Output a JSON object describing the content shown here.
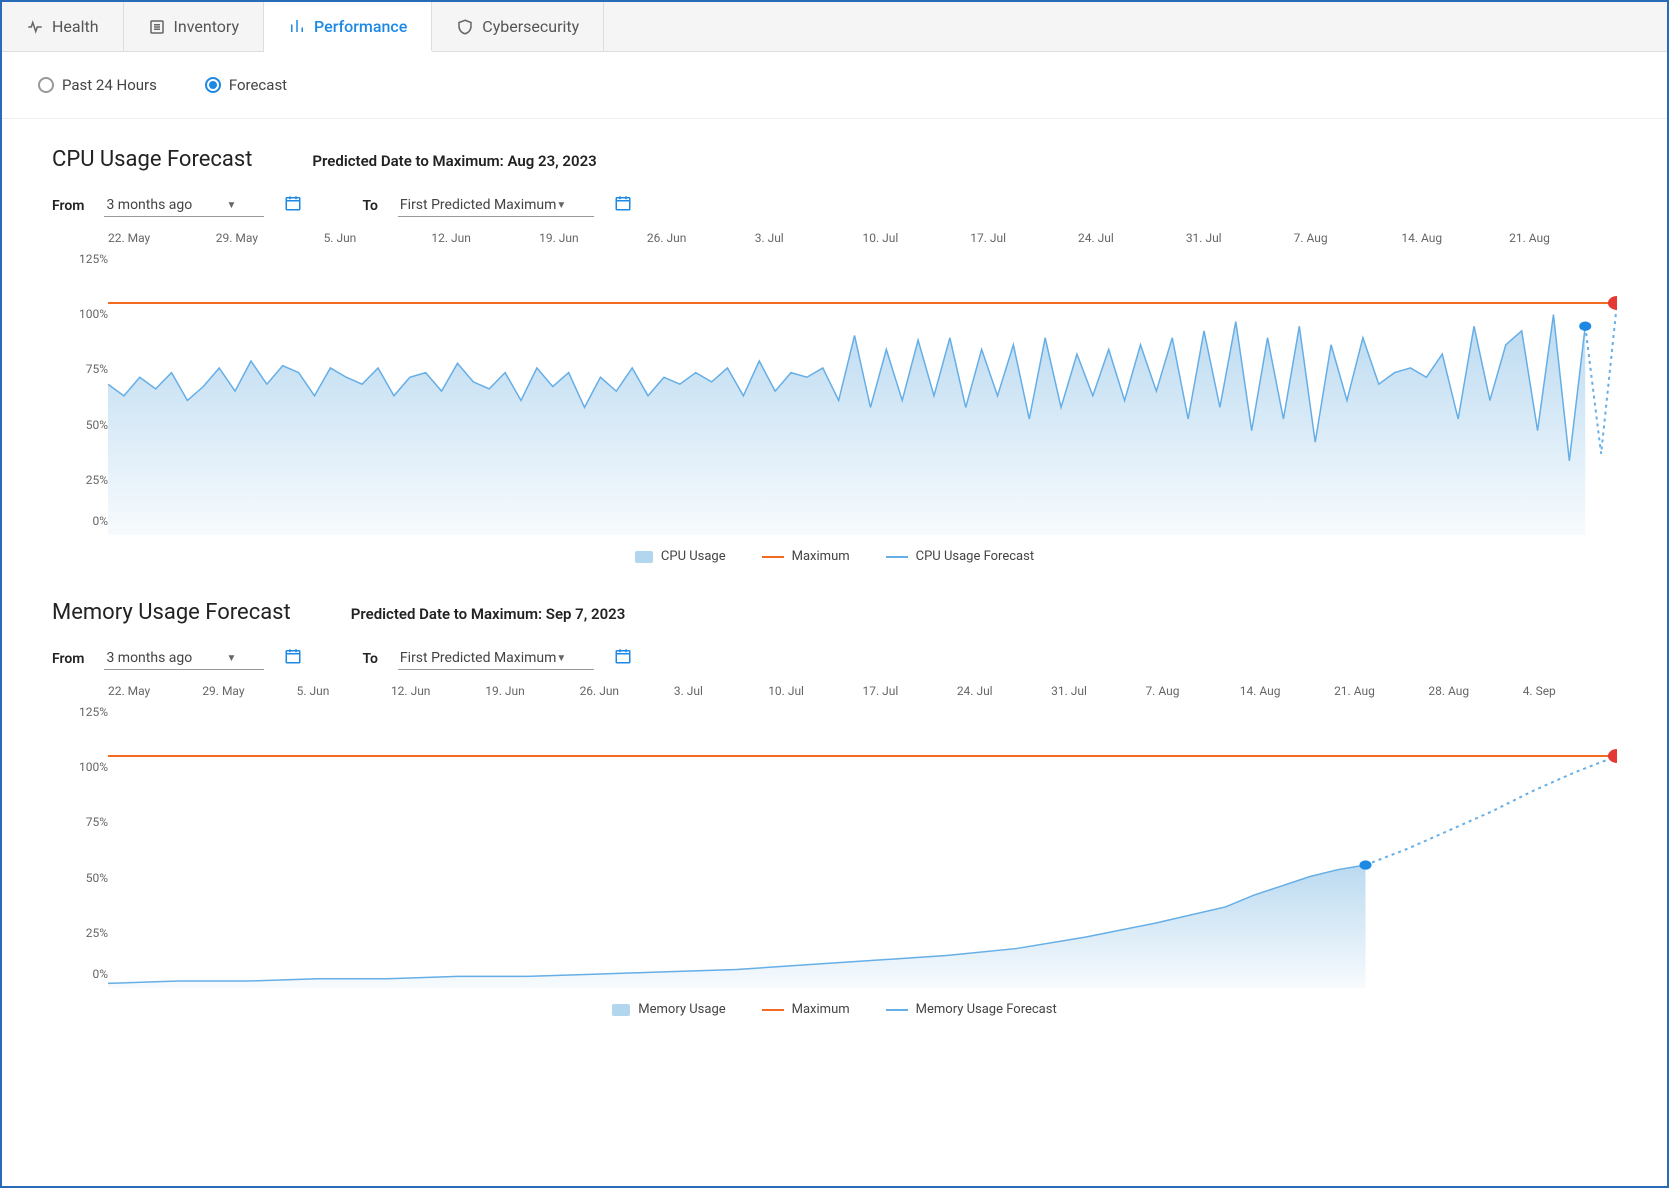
{
  "tabs": [
    {
      "label": "Health",
      "icon": "heart"
    },
    {
      "label": "Inventory",
      "icon": "list"
    },
    {
      "label": "Performance",
      "icon": "bars"
    },
    {
      "label": "Cybersecurity",
      "icon": "shield"
    }
  ],
  "active_tab": 2,
  "time_options": [
    {
      "label": "Past 24 Hours"
    },
    {
      "label": "Forecast"
    }
  ],
  "time_selected": 1,
  "panels": {
    "cpu": {
      "title": "CPU Usage Forecast",
      "subtitle": "Predicted Date to Maximum: Aug 23, 2023",
      "from_label": "From",
      "to_label": "To",
      "from_value": "3 months ago",
      "to_value": "First Predicted Maximum",
      "legend": [
        "CPU Usage",
        "Maximum",
        "CPU Usage Forecast"
      ]
    },
    "mem": {
      "title": "Memory Usage Forecast",
      "subtitle": "Predicted Date to Maximum: Sep 7, 2023",
      "from_label": "From",
      "to_label": "To",
      "from_value": "3 months ago",
      "to_value": "First Predicted Maximum",
      "legend": [
        "Memory Usage",
        "Maximum",
        "Memory Usage Forecast"
      ]
    }
  },
  "chart_data": [
    {
      "type": "area",
      "title": "CPU Usage Forecast",
      "ylabel": "%",
      "ylim": [
        0,
        125
      ],
      "y_ticks": [
        "125%",
        "100%",
        "75%",
        "50%",
        "25%",
        "0%"
      ],
      "x_labels": [
        "22. May",
        "29. May",
        "5. Jun",
        "12. Jun",
        "19. Jun",
        "26. Jun",
        "3. Jul",
        "10. Jul",
        "17. Jul",
        "24. Jul",
        "31. Jul",
        "7. Aug",
        "14. Aug",
        "21. Aug"
      ],
      "max_line": 100,
      "series": [
        {
          "name": "CPU Usage",
          "color": "#b3d6ef",
          "x": [
            0,
            1,
            2,
            3,
            4,
            5,
            6,
            7,
            8,
            9,
            10,
            11,
            12,
            13,
            14,
            15,
            16,
            17,
            18,
            19,
            20,
            21,
            22,
            23,
            24,
            25,
            26,
            27,
            28,
            29,
            30,
            31,
            32,
            33,
            34,
            35,
            36,
            37,
            38,
            39,
            40,
            41,
            42,
            43,
            44,
            45,
            46,
            47,
            48,
            49,
            50,
            51,
            52,
            53,
            54,
            55,
            56,
            57,
            58,
            59,
            60,
            61,
            62,
            63,
            64,
            65,
            66,
            67,
            68,
            69,
            70,
            71,
            72,
            73,
            74,
            75,
            76,
            77,
            78,
            79,
            80,
            81,
            82,
            83,
            84,
            85,
            86,
            87,
            88,
            89,
            90,
            91,
            92,
            93
          ],
          "values": [
            65,
            60,
            68,
            63,
            70,
            58,
            64,
            72,
            62,
            75,
            65,
            73,
            70,
            60,
            72,
            68,
            65,
            72,
            60,
            68,
            70,
            62,
            74,
            66,
            63,
            70,
            58,
            72,
            64,
            70,
            55,
            68,
            62,
            72,
            60,
            68,
            65,
            70,
            66,
            72,
            60,
            75,
            62,
            70,
            68,
            72,
            58,
            86,
            55,
            80,
            58,
            84,
            60,
            85,
            55,
            80,
            60,
            82,
            50,
            85,
            55,
            78,
            60,
            80,
            58,
            82,
            62,
            85,
            50,
            88,
            55,
            92,
            45,
            85,
            50,
            90,
            40,
            82,
            58,
            85,
            65,
            70,
            72,
            68,
            78,
            50,
            90,
            58,
            82,
            88,
            45,
            95,
            32,
            90
          ]
        },
        {
          "name": "CPU Usage Forecast",
          "color": "#66aee6",
          "dotted": true,
          "x": [
            93,
            94,
            95
          ],
          "values": [
            90,
            35,
            100
          ]
        }
      ],
      "end_marker": {
        "x": 95,
        "y": 100,
        "color": "#e53935"
      },
      "actual_marker": {
        "x": 93,
        "y": 90,
        "color": "#1e88e5"
      }
    },
    {
      "type": "area",
      "title": "Memory Usage Forecast",
      "ylabel": "%",
      "ylim": [
        0,
        125
      ],
      "y_ticks": [
        "125%",
        "100%",
        "75%",
        "50%",
        "25%",
        "0%"
      ],
      "x_labels": [
        "22. May",
        "29. May",
        "5. Jun",
        "12. Jun",
        "19. Jun",
        "26. Jun",
        "3. Jul",
        "10. Jul",
        "17. Jul",
        "24. Jul",
        "31. Jul",
        "7. Aug",
        "14. Aug",
        "21. Aug",
        "28. Aug",
        "4. Sep"
      ],
      "max_line": 100,
      "series": [
        {
          "name": "Memory Usage",
          "color": "#b3d6ef",
          "x": [
            0,
            5,
            10,
            15,
            20,
            25,
            30,
            35,
            40,
            45,
            50,
            55,
            60,
            65,
            70,
            75,
            80,
            82,
            84,
            86,
            88,
            90
          ],
          "values": [
            2,
            3,
            3,
            4,
            4,
            5,
            5,
            6,
            7,
            8,
            10,
            12,
            14,
            17,
            22,
            28,
            35,
            40,
            44,
            48,
            51,
            53
          ]
        },
        {
          "name": "Memory Usage Forecast",
          "color": "#66aee6",
          "dotted": true,
          "x": [
            90,
            93,
            96,
            99,
            102,
            105,
            108
          ],
          "values": [
            53,
            60,
            68,
            76,
            85,
            93,
            100
          ]
        }
      ],
      "end_marker": {
        "x": 108,
        "y": 100,
        "color": "#e53935"
      },
      "actual_marker": {
        "x": 90,
        "y": 53,
        "color": "#1e88e5"
      }
    }
  ]
}
